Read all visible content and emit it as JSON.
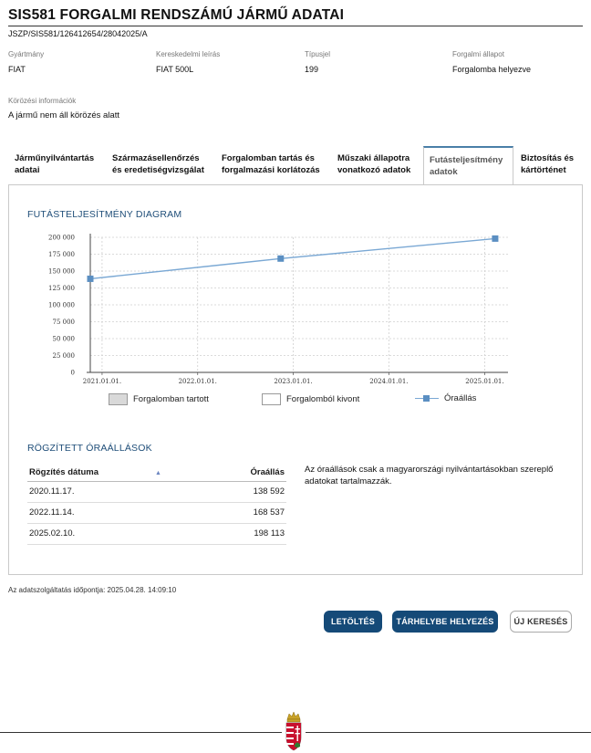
{
  "header": {
    "title": "SIS581 FORGALMI RENDSZÁMÚ JÁRMŰ ADATAI",
    "doc_id": "JSZP/SIS581/126412654/28042025/A"
  },
  "fields": [
    {
      "label": "Gyártmány",
      "value": "FIAT"
    },
    {
      "label": "Kereskedelmi leírás",
      "value": "FIAT 500L"
    },
    {
      "label": "Típusjel",
      "value": "199"
    },
    {
      "label": "Forgalmi állapot",
      "value": "Forgalomba helyezve"
    }
  ],
  "circulation": {
    "label": "Körözési információk",
    "value": "A jármű nem áll körözés alatt"
  },
  "tabs": [
    {
      "line1": "Járműnyilvántartás",
      "line2": "adatai"
    },
    {
      "line1": "Származásellenőrzés",
      "line2": "és eredetiségvizsgálat"
    },
    {
      "line1": "Forgalomban tartás és",
      "line2": "forgalmazási korlátozás"
    },
    {
      "line1": "Műszaki állapotra",
      "line2": "vonatkozó adatok"
    },
    {
      "line1": "Futásteljesítmény",
      "line2": "adatok"
    },
    {
      "line1": "Biztosítás és",
      "line2": "kártörténet"
    }
  ],
  "active_tab": 4,
  "chart_title": "FUTÁSTELJESÍTMÉNY DIAGRAM",
  "chart_data": {
    "type": "line",
    "x_ticks": [
      "2021.01.01.",
      "2022.01.01.",
      "2023.01.01.",
      "2024.01.01.",
      "2025.01.01."
    ],
    "y_ticks": [
      "0",
      "25 000",
      "50 000",
      "75 000",
      "100 000",
      "125 000",
      "150 000",
      "175 000",
      "200 000"
    ],
    "ylim": [
      0,
      200000
    ],
    "xlim": [
      "2020-11-17",
      "2025-03-31"
    ],
    "series": [
      {
        "name": "Óraállás",
        "color": "#5b8fc2",
        "points": [
          {
            "x": "2020-11-17",
            "y": 138592
          },
          {
            "x": "2022-11-14",
            "y": 168537
          },
          {
            "x": "2025-02-10",
            "y": 198113
          }
        ]
      }
    ],
    "legend": [
      "Forgalomban tartott",
      "Forgalomból kivont",
      "Óraállás"
    ],
    "grid": true
  },
  "odometer": {
    "title": "RÖGZÍTETT ÓRAÁLLÁSOK",
    "col_date": "Rögzítés dátuma",
    "col_value": "Óraállás",
    "rows": [
      {
        "date": "2020.11.17.",
        "value": "138 592"
      },
      {
        "date": "2022.11.14.",
        "value": "168 537"
      },
      {
        "date": "2025.02.10.",
        "value": "198 113"
      }
    ],
    "note": "Az óraállások csak a magyarországi nyilvántartásokban szereplő adatokat tartalmazzák."
  },
  "timestamp": "Az adatszolgáltatás időpontja: 2025.04.28. 14:09:10",
  "buttons": {
    "download": "LETÖLTÉS",
    "store": "TÁRHELYBE HELYEZÉS",
    "new_search": "ÚJ KERESÉS"
  }
}
